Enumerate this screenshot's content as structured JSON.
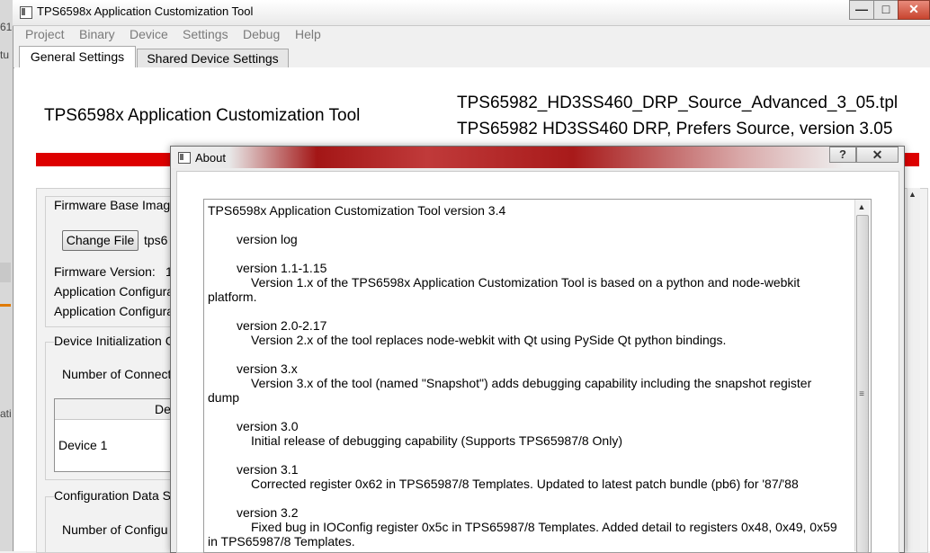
{
  "background_window": {
    "fragments": [
      "61",
      "tu",
      "ati"
    ]
  },
  "window": {
    "title": "TPS6598x Application Customization Tool",
    "buttons": {
      "minimize": "—",
      "maximize": "□",
      "close": "✕"
    }
  },
  "menu": [
    "Project",
    "Binary",
    "Device",
    "Settings",
    "Debug",
    "Help"
  ],
  "tabs": [
    {
      "label": "General Settings"
    },
    {
      "label": "Shared Device Settings"
    }
  ],
  "header": {
    "app_title": "TPS6598x Application Customization Tool",
    "template_file": "TPS65982_HD3SS460_DRP_Source_Advanced_3_05.tpl",
    "template_desc": "TPS65982 HD3SS460 DRP, Prefers Source, version 3.05"
  },
  "main": {
    "firmware_group": "Firmware Base Imag",
    "change_file_button": "Change File",
    "file_name": "tps6",
    "firmware_version_label": "Firmware Version:",
    "firmware_version_value": "1",
    "app_config_1": "Application Configura",
    "app_config_2": "Application Configura",
    "device_init_group": "Device Initialization C",
    "num_connected": "Number of Connect",
    "device_col_header": "Devi",
    "device_row": "Device 1",
    "config_data_group": "Configuration Data S",
    "num_config": "Number of Configu"
  },
  "dialog": {
    "title": "About",
    "help_button": "?",
    "close_button": "✕",
    "lines": [
      "TPS6598x Application Customization Tool version 3.4",
      "version log",
      "version 1.1-1.15",
      "Version 1.x of the TPS6598x Application Customization Tool is based on a python and node-webkit",
      "platform.",
      "version 2.0-2.17",
      "Version 2.x of the tool replaces node-webkit with Qt using PySide Qt python bindings.",
      "version 3.x",
      "Version 3.x of the tool (named \"Snapshot\") adds debugging capability including the snapshot register",
      "dump",
      "version 3.0",
      "Initial release of debugging capability (Supports TPS65987/8 Only)",
      "version 3.1",
      "Corrected register 0x62 in TPS65987/8 Templates.  Updated to latest patch bundle (pb6) for '87/'88",
      "version 3.2",
      "Fixed bug in IOConfig register 0x5c in TPS65987/8 Templates. Added detail to registers 0x48, 0x49, 0x59",
      "in TPS65987/8 Templates."
    ],
    "scroll_up": "▲",
    "scroll_grip": "≡"
  }
}
